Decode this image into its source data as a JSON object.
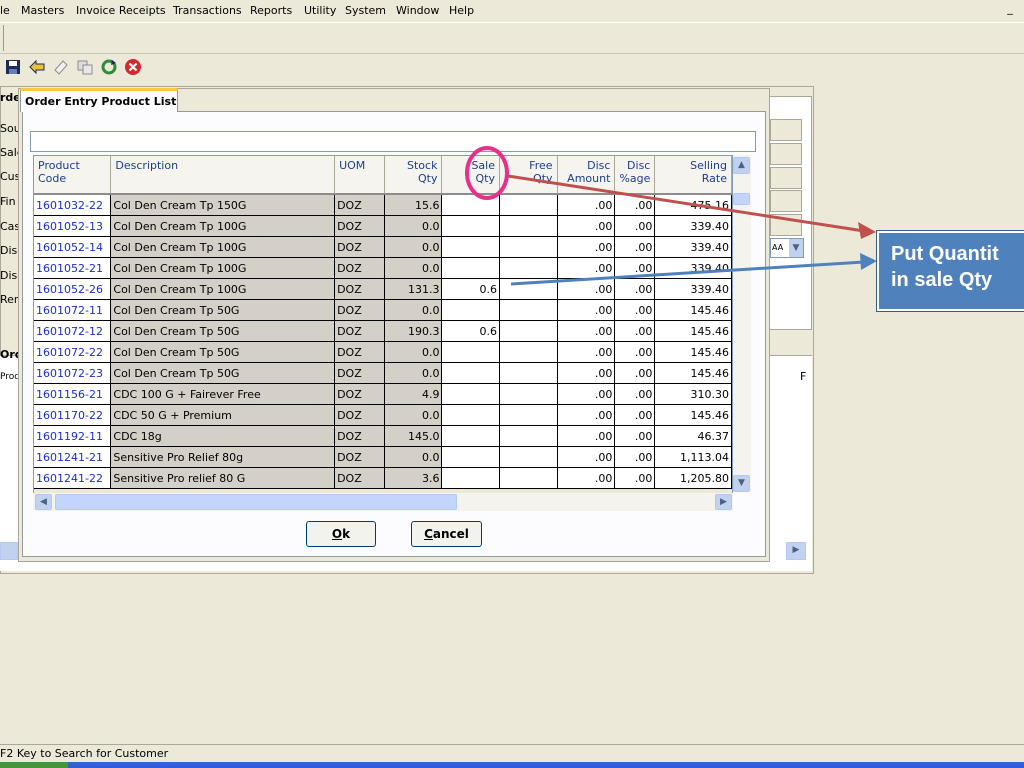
{
  "menu": {
    "items": [
      "le",
      "Masters",
      "Invoice Receipts",
      "Transactions",
      "Reports",
      "Utility",
      "System",
      "Window",
      "Help"
    ],
    "minimize": "_"
  },
  "toolbar": {
    "icons": [
      "save-icon",
      "back-icon",
      "eraser-icon",
      "copy-icon",
      "refresh-icon",
      "close-icon"
    ]
  },
  "background_form": {
    "labels": [
      "rde",
      "Sou",
      "Sale",
      "Cus",
      "Fin",
      "Cas",
      "Disc",
      "Disc",
      "Ren",
      "Orde",
      "Prod"
    ],
    "combo_text": "AA",
    "right_header": "F"
  },
  "dialog": {
    "tab_label": "Order Entry Product List",
    "search_value": "",
    "columns": [
      {
        "key": "code",
        "label_1": "Product",
        "label_2": "Code",
        "align": "l"
      },
      {
        "key": "desc",
        "label_1": "Description",
        "label_2": "",
        "align": "l"
      },
      {
        "key": "uom",
        "label_1": "UOM",
        "label_2": "",
        "align": "l"
      },
      {
        "key": "stock",
        "label_1": "Stock",
        "label_2": "Qty",
        "align": "r"
      },
      {
        "key": "sale",
        "label_1": "Sale",
        "label_2": "Qty",
        "align": "r"
      },
      {
        "key": "free",
        "label_1": "Free",
        "label_2": "Qty",
        "align": "r"
      },
      {
        "key": "disc_amt",
        "label_1": "Disc",
        "label_2": "Amount",
        "align": "r"
      },
      {
        "key": "disc_pct",
        "label_1": "Disc",
        "label_2": "%age",
        "align": "r"
      },
      {
        "key": "rate",
        "label_1": "Selling",
        "label_2": "Rate",
        "align": "r"
      }
    ],
    "rows": [
      {
        "code": "1601032-22",
        "desc": "Col Den Cream Tp 150G",
        "uom": "DOZ",
        "stock": "15.6",
        "sale": "",
        "free": "",
        "disc_amt": ".00",
        "disc_pct": ".00",
        "rate": "475.16"
      },
      {
        "code": "1601052-13",
        "desc": "Col Den Cream Tp 100G",
        "uom": "DOZ",
        "stock": "0.0",
        "sale": "",
        "free": "",
        "disc_amt": ".00",
        "disc_pct": ".00",
        "rate": "339.40"
      },
      {
        "code": "1601052-14",
        "desc": "Col Den Cream Tp 100G",
        "uom": "DOZ",
        "stock": "0.0",
        "sale": "",
        "free": "",
        "disc_amt": ".00",
        "disc_pct": ".00",
        "rate": "339.40"
      },
      {
        "code": "1601052-21",
        "desc": "Col Den Cream Tp 100G",
        "uom": "DOZ",
        "stock": "0.0",
        "sale": "",
        "free": "",
        "disc_amt": ".00",
        "disc_pct": ".00",
        "rate": "339.40"
      },
      {
        "code": "1601052-26",
        "desc": "Col Den Cream Tp 100G",
        "uom": "DOZ",
        "stock": "131.3",
        "sale": "0.6",
        "free": "",
        "disc_amt": ".00",
        "disc_pct": ".00",
        "rate": "339.40"
      },
      {
        "code": "1601072-11",
        "desc": "Col Den Cream Tp 50G",
        "uom": "DOZ",
        "stock": "0.0",
        "sale": "",
        "free": "",
        "disc_amt": ".00",
        "disc_pct": ".00",
        "rate": "145.46"
      },
      {
        "code": "1601072-12",
        "desc": "Col Den Cream Tp 50G",
        "uom": "DOZ",
        "stock": "190.3",
        "sale": "0.6",
        "free": "",
        "disc_amt": ".00",
        "disc_pct": ".00",
        "rate": "145.46"
      },
      {
        "code": "1601072-22",
        "desc": "Col Den Cream Tp 50G",
        "uom": "DOZ",
        "stock": "0.0",
        "sale": "",
        "free": "",
        "disc_amt": ".00",
        "disc_pct": ".00",
        "rate": "145.46"
      },
      {
        "code": "1601072-23",
        "desc": "Col Den Cream Tp 50G",
        "uom": "DOZ",
        "stock": "0.0",
        "sale": "",
        "free": "",
        "disc_amt": ".00",
        "disc_pct": ".00",
        "rate": "145.46"
      },
      {
        "code": "1601156-21",
        "desc": "CDC 100 G + Fairever Free",
        "uom": "DOZ",
        "stock": "4.9",
        "sale": "",
        "free": "",
        "disc_amt": ".00",
        "disc_pct": ".00",
        "rate": "310.30"
      },
      {
        "code": "1601170-22",
        "desc": "CDC 50 G + Premium",
        "uom": "DOZ",
        "stock": "0.0",
        "sale": "",
        "free": "",
        "disc_amt": ".00",
        "disc_pct": ".00",
        "rate": "145.46"
      },
      {
        "code": "1601192-11",
        "desc": "CDC 18g",
        "uom": "DOZ",
        "stock": "145.0",
        "sale": "",
        "free": "",
        "disc_amt": ".00",
        "disc_pct": ".00",
        "rate": "46.37"
      },
      {
        "code": "1601241-21",
        "desc": "Sensitive Pro Relief 80g",
        "uom": "DOZ",
        "stock": "0.0",
        "sale": "",
        "free": "",
        "disc_amt": ".00",
        "disc_pct": ".00",
        "rate": "1,113.04"
      },
      {
        "code": "1601241-22",
        "desc": "Sensitive Pro relief 80 G",
        "uom": "DOZ",
        "stock": "3.6",
        "sale": "",
        "free": "",
        "disc_amt": ".00",
        "disc_pct": ".00",
        "rate": "1,205.80"
      }
    ],
    "ok_mnemonic": "O",
    "ok_rest": "k",
    "cancel_mnemonic": "C",
    "cancel_rest": "ancel"
  },
  "statusbar": {
    "text": "F2 Key to Search for Customer"
  },
  "annotation": {
    "line1": "Put Quantit",
    "line2": "in  sale  Qty",
    "callout_color": "#4f81bd",
    "highlight_color": "#e8308a",
    "red_arrow_color": "#c0504d",
    "blue_arrow_color": "#4f81bd"
  }
}
